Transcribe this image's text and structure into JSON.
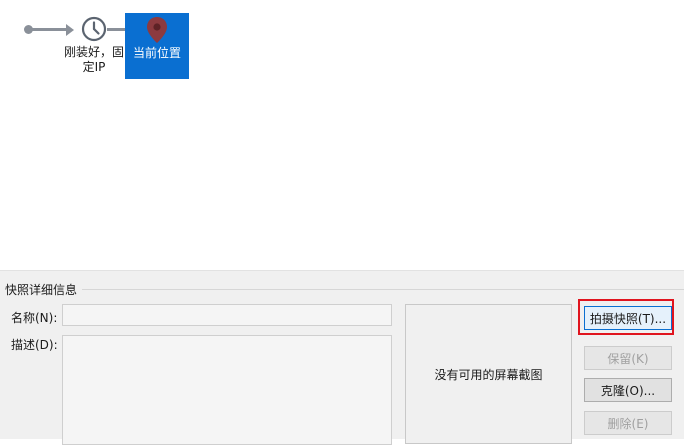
{
  "tree": {
    "snapshot_node": {
      "label": "刚装好，固定IP",
      "icon": "clock-icon"
    },
    "current_node": {
      "label": "当前位置",
      "icon": "map-pin-icon",
      "background_color": "#0a6fd1"
    }
  },
  "details": {
    "group_title": "快照详细信息",
    "name_label": "名称(N):",
    "name_value": "",
    "description_label": "描述(D):",
    "description_value": "",
    "no_screenshot_text": "没有可用的屏幕截图"
  },
  "buttons": {
    "take_snapshot": "拍摄快照(T)...",
    "keep": "保留(K)",
    "clone": "克隆(O)...",
    "delete": "删除(E)"
  },
  "colors": {
    "accent": "#0a6fd1",
    "highlight": "#e0141e"
  }
}
